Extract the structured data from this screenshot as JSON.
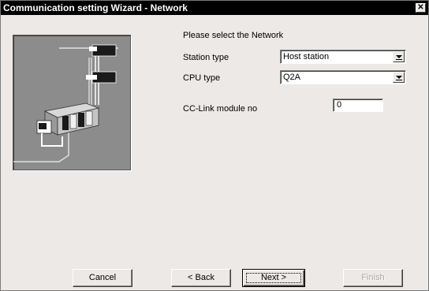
{
  "window": {
    "title": "Communication setting Wizard - Network",
    "close_glyph": "✕"
  },
  "content": {
    "heading": "Please select the Network",
    "station_type": {
      "label": "Station type",
      "value": "Host station"
    },
    "cpu_type": {
      "label": "CPU type",
      "value": "Q2A"
    },
    "cc_link": {
      "label": "CC-Link module no",
      "value": "0"
    }
  },
  "buttons": {
    "cancel": "Cancel",
    "back": "< Back",
    "next": "Next >",
    "finish": "Finish"
  },
  "colors": {
    "titlebar": "#000000",
    "dialog": "#ece9e6",
    "illustration_bg": "#8c8c8c"
  },
  "icons": {
    "illustration": "network-plc-illustration",
    "close": "close-icon",
    "dropdown": "chevron-down-icon"
  }
}
